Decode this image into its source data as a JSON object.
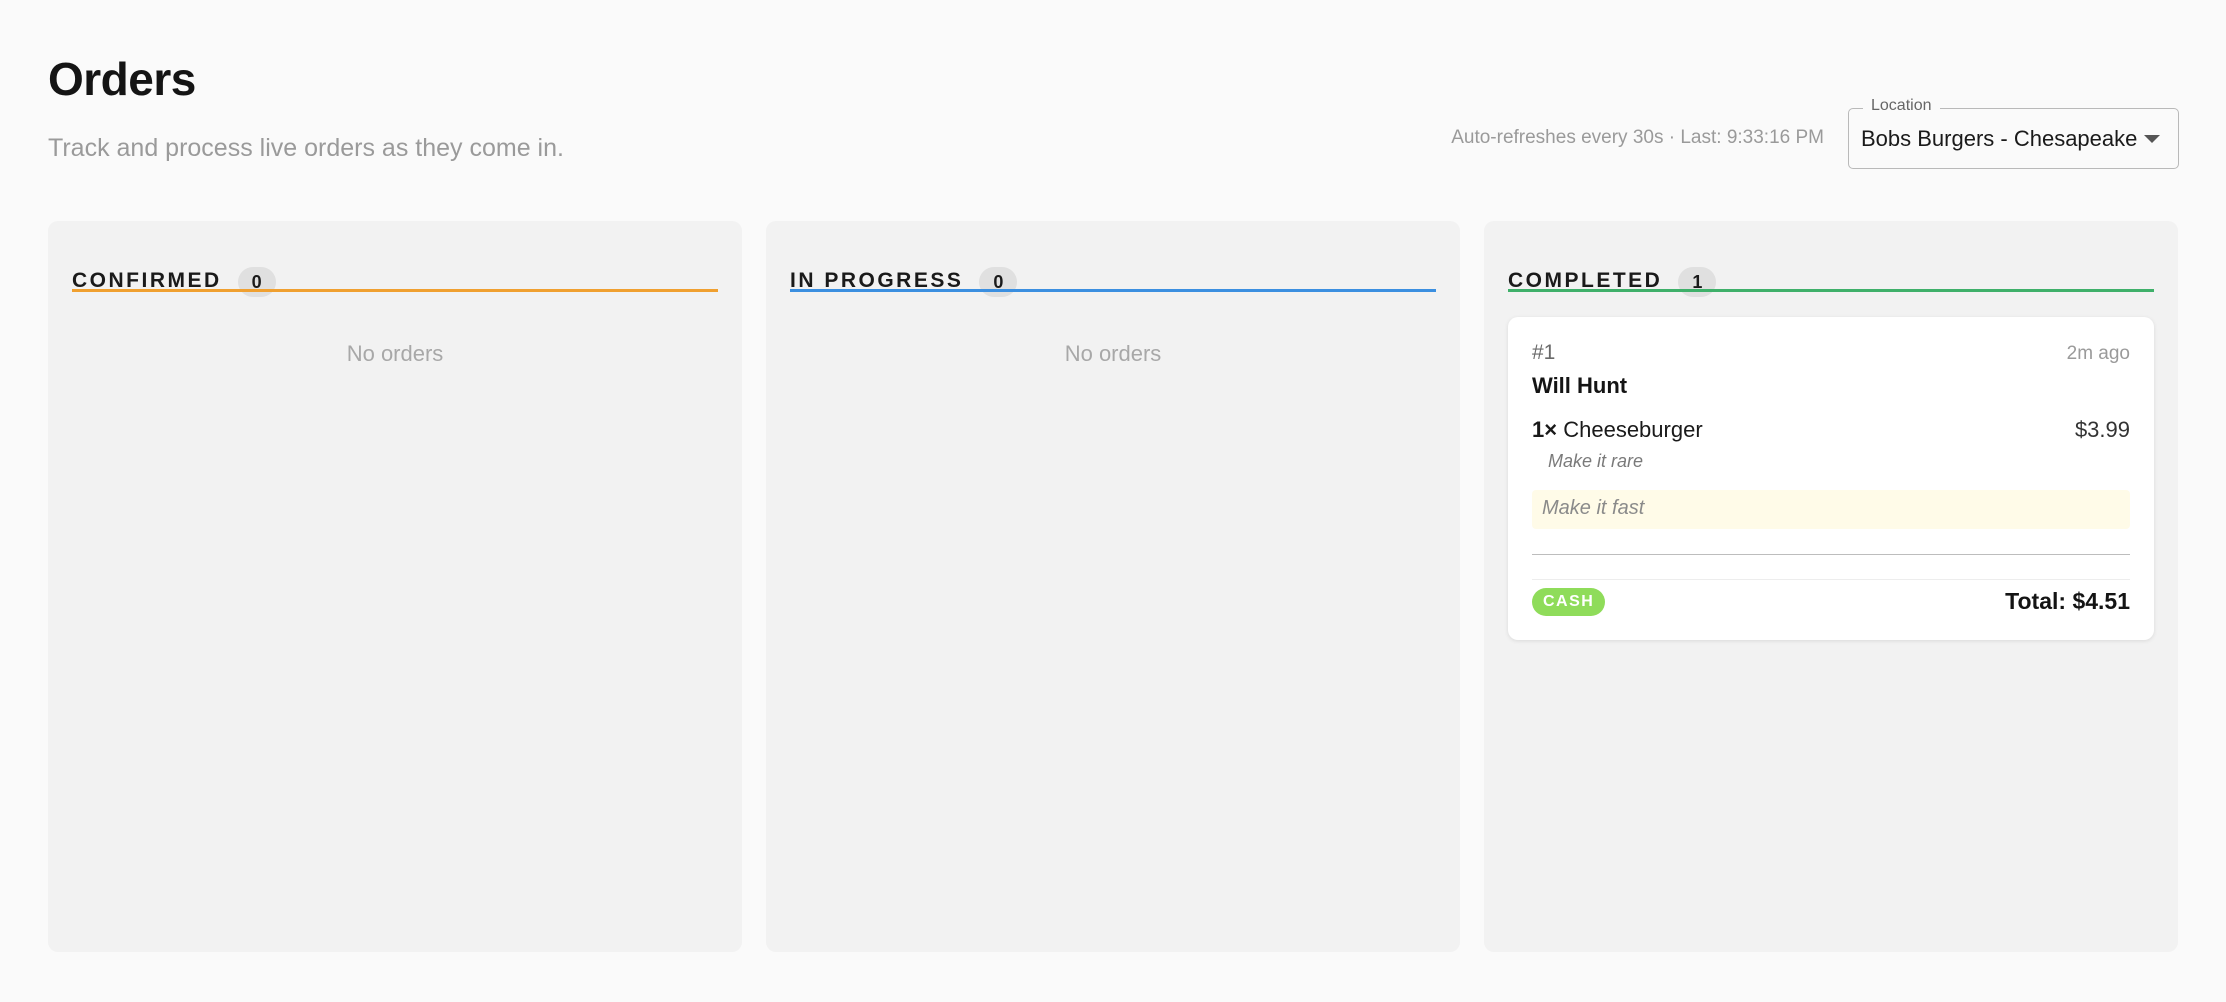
{
  "header": {
    "title": "Orders",
    "subtitle": "Track and process live orders as they come in.",
    "refresh_status": "Auto-refreshes every 30s · Last: 9:33:16 PM"
  },
  "location": {
    "label": "Location",
    "selected": "Bobs Burgers - Chesapeake"
  },
  "columns": [
    {
      "title": "CONFIRMED",
      "count": "0",
      "empty_text": "No orders",
      "accent": "#f0a030"
    },
    {
      "title": "IN PROGRESS",
      "count": "0",
      "empty_text": "No orders",
      "accent": "#3b8fe0"
    },
    {
      "title": "COMPLETED",
      "count": "1",
      "accent": "#3fb06a"
    }
  ],
  "completed_orders": [
    {
      "number": "#1",
      "time_ago": "2m ago",
      "customer": "Will Hunt",
      "items": [
        {
          "qty": "1×",
          "name": "Cheeseburger",
          "price": "$3.99",
          "note": "Make it rare"
        }
      ],
      "order_note": "Make it fast",
      "payment": "CASH",
      "total": "Total: $4.51"
    }
  ],
  "colors": {
    "payment_badge": "#8fdc5a",
    "order_note_bg": "#fffbe8"
  }
}
